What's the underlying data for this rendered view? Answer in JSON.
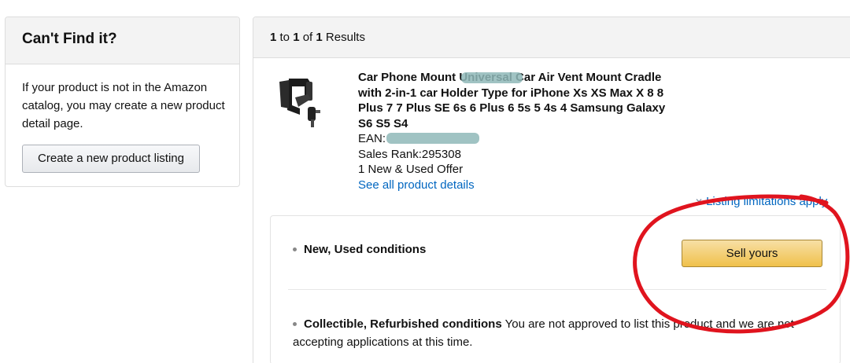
{
  "sidebar": {
    "title": "Can't Find it?",
    "description": "If your product is not in the Amazon catalog, you may create a new product detail page.",
    "create_button": "Create a new product listing"
  },
  "results": {
    "range_start": "1",
    "to_text": "to",
    "range_end": "1",
    "of_text": "of",
    "total": "1",
    "results_label": "Results"
  },
  "product": {
    "title": "Car Phone Mount Universal Car Air Vent Mount Cradle with 2-in-1 car Holder Type for iPhone Xs XS Max X 8 8 Plus 7 7 Plus SE 6s 6 Plus 6 5s 5 4s 4 Samsung Galaxy S6 S5 S4",
    "ean_label": "EAN:",
    "sales_rank": "Sales Rank:295308",
    "offers": "1 New & Used Offer",
    "details_link": "See all product details",
    "limitations_link": "Listing limitations apply"
  },
  "conditions": {
    "row1_label": "New, Used conditions",
    "sell_button": "Sell yours",
    "row2_label": "Collectible, Refurbished conditions",
    "row2_text": "You are not approved to list this product and we are not accepting applications at this time."
  },
  "colors": {
    "link": "#0066c0",
    "sell_button": "#f0c14b",
    "annotation_circle": "#e0141e"
  }
}
